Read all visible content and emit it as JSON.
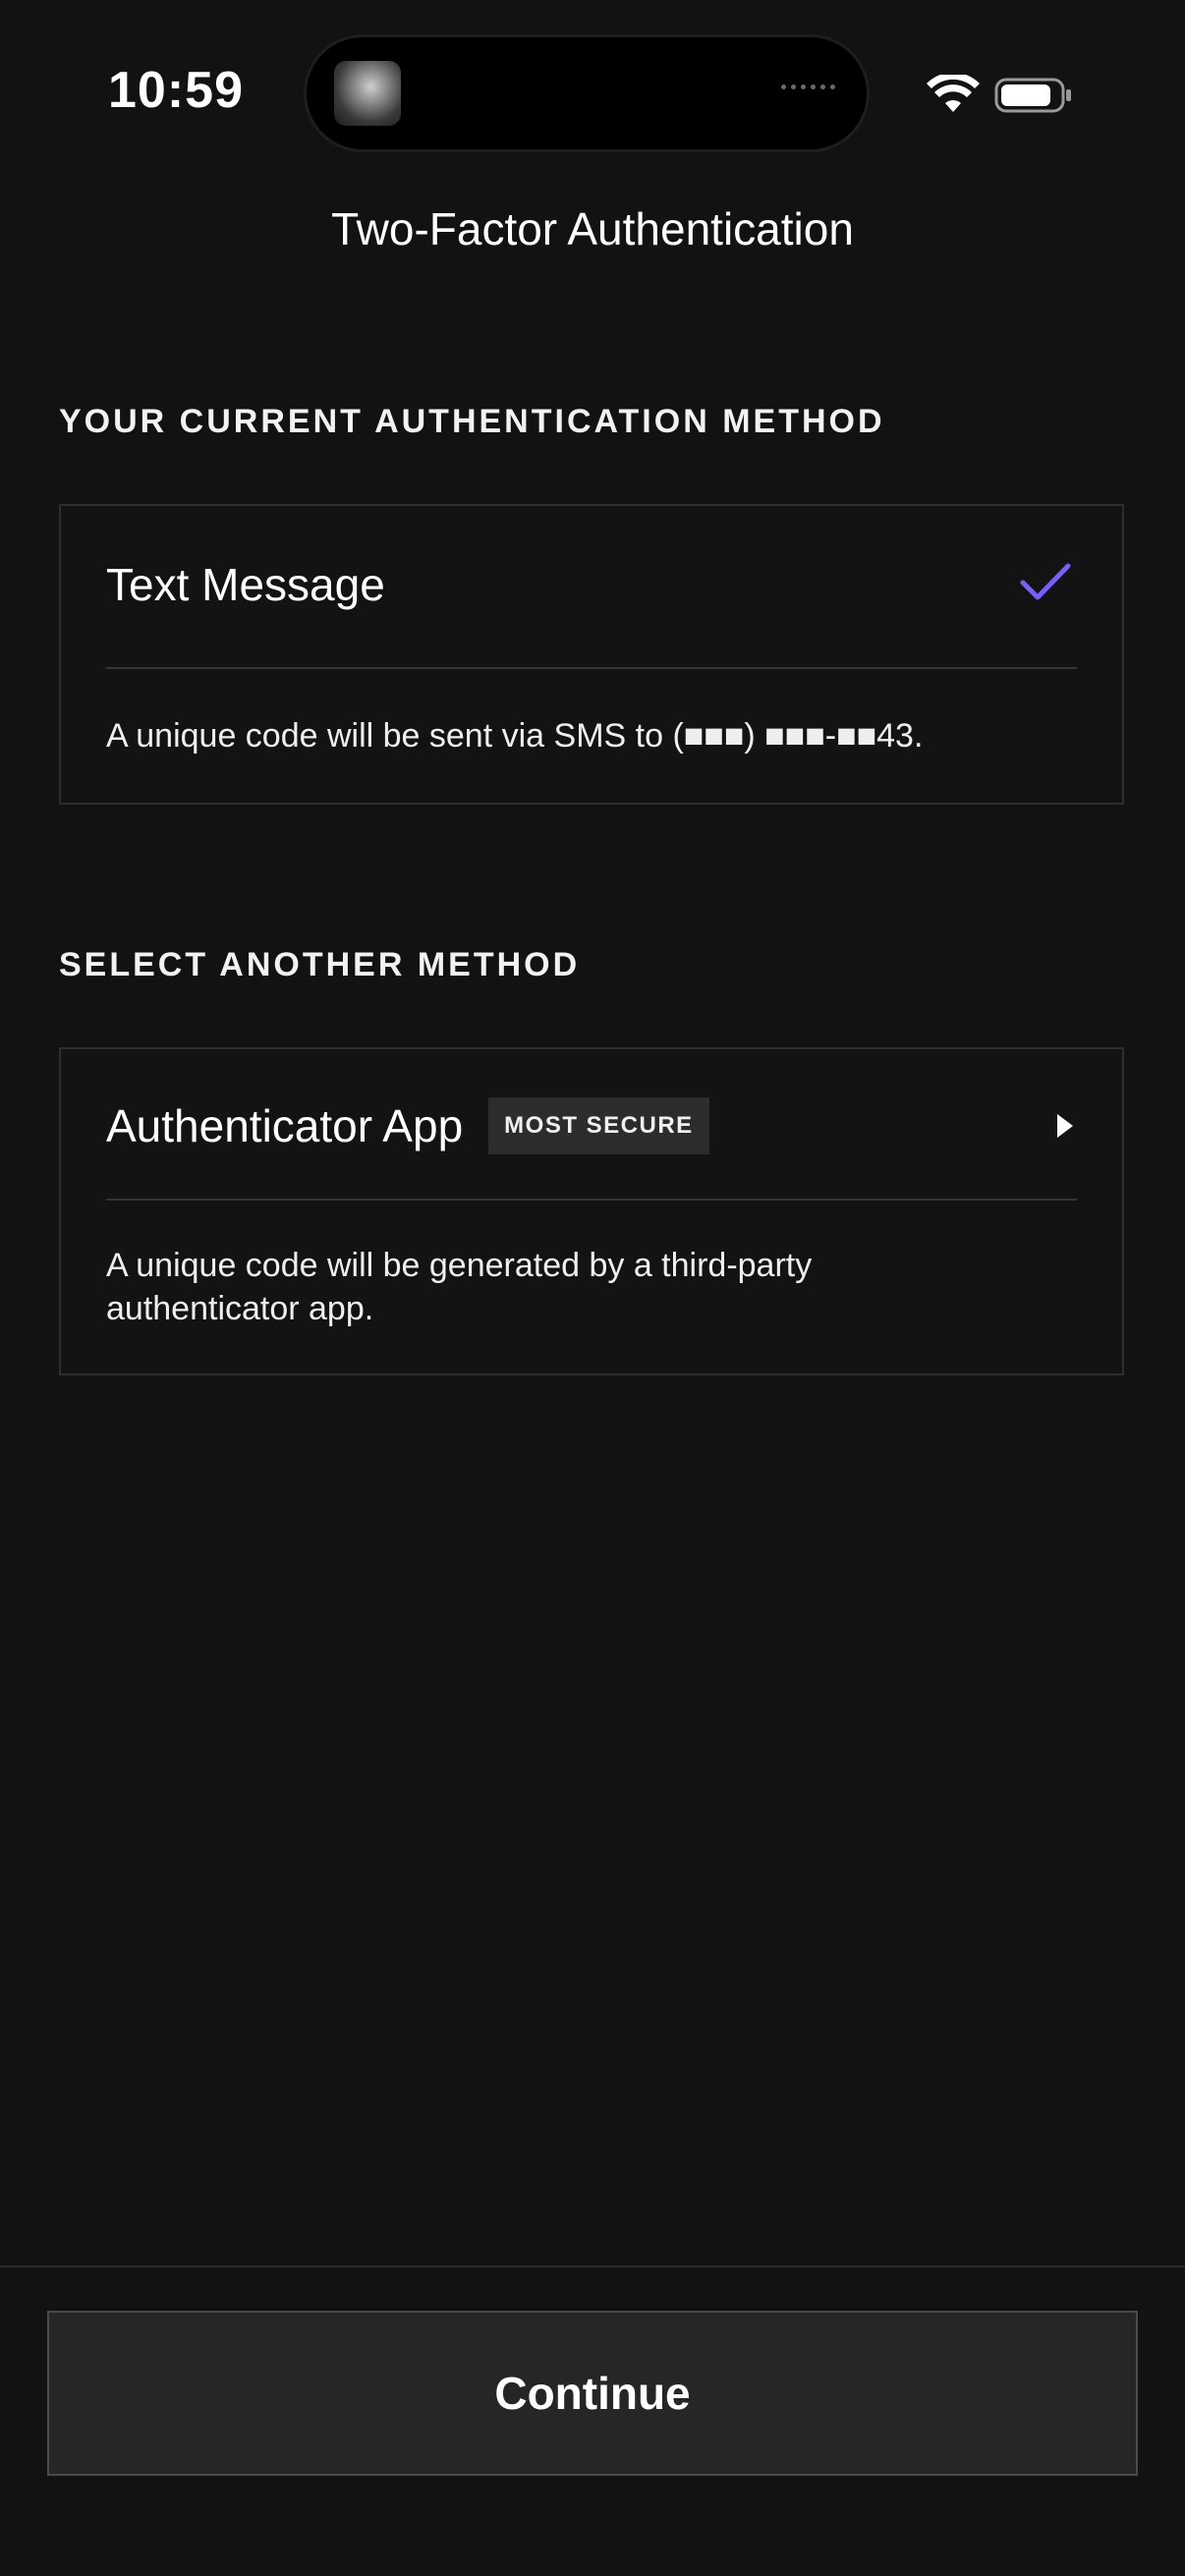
{
  "status_bar": {
    "time": "10:59"
  },
  "header": {
    "title": "Two-Factor Authentication"
  },
  "current_section": {
    "label": "YOUR CURRENT AUTHENTICATION METHOD",
    "method": {
      "title": "Text Message",
      "description": "A unique code will be sent via SMS to (■■■) ■■■-■■43.",
      "selected": true
    }
  },
  "other_section": {
    "label": "SELECT ANOTHER METHOD",
    "method": {
      "title": "Authenticator App",
      "badge": "MOST SECURE",
      "description_line1": "A unique code will be generated by a third-party",
      "description_line2": "authenticator app."
    }
  },
  "footer": {
    "continue_label": "Continue"
  },
  "colors": {
    "background": "#121212",
    "accent_check": "#7b5cff",
    "button_bg": "#262626"
  },
  "icons": [
    "wifi-icon",
    "battery-icon",
    "check-icon",
    "chevron-right-icon"
  ]
}
